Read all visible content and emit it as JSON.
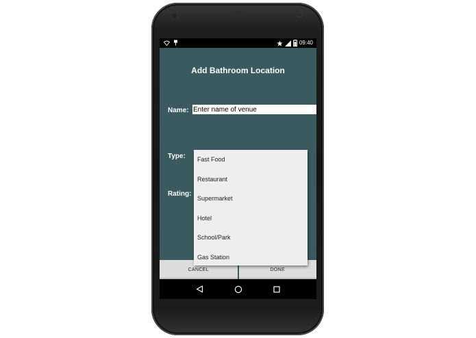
{
  "status_bar": {
    "time": "09:40",
    "icons_left": [
      "wifi-icon",
      "usb-icon"
    ],
    "icons_right": [
      "star-icon",
      "signal-icon",
      "battery-icon"
    ]
  },
  "app": {
    "title": "Add Bathroom Location"
  },
  "form": {
    "name_label": "Name:",
    "name_placeholder": "Enter name of venue",
    "type_label": "Type:",
    "rating_label": "Rating:"
  },
  "type_dropdown": {
    "options": [
      "Fast Food",
      "Restaurant",
      "Supermarket",
      "Hotel",
      "School/Park",
      "Gas Station"
    ]
  },
  "buttons": {
    "cancel": "CANCEL",
    "done": "DONE"
  },
  "navigation": {
    "icons": [
      "back-icon",
      "home-icon",
      "recents-icon"
    ]
  },
  "colors": {
    "app_background": "#3a5a60",
    "dropdown_background": "#eeeeee",
    "button_background": "#dcdcdc"
  }
}
